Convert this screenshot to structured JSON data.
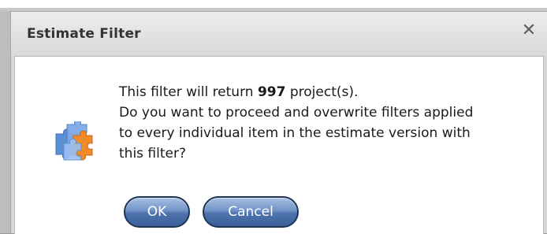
{
  "dialog": {
    "title": "Estimate Filter",
    "close_icon": "close-icon",
    "message": {
      "line1_prefix": "This filter will return ",
      "project_count": "997",
      "line1_suffix": " project(s).",
      "line2": "Do you want to proceed and overwrite filters applied",
      "line3": "to every individual item in the estimate version with",
      "line4": "this filter?"
    },
    "icon": "puzzle-pieces-icon",
    "buttons": {
      "ok_label": "OK",
      "cancel_label": "Cancel"
    }
  },
  "colors": {
    "button_blue": "#4e73ad",
    "button_border": "#1d3458",
    "titlebar": "#e3e3e3"
  }
}
